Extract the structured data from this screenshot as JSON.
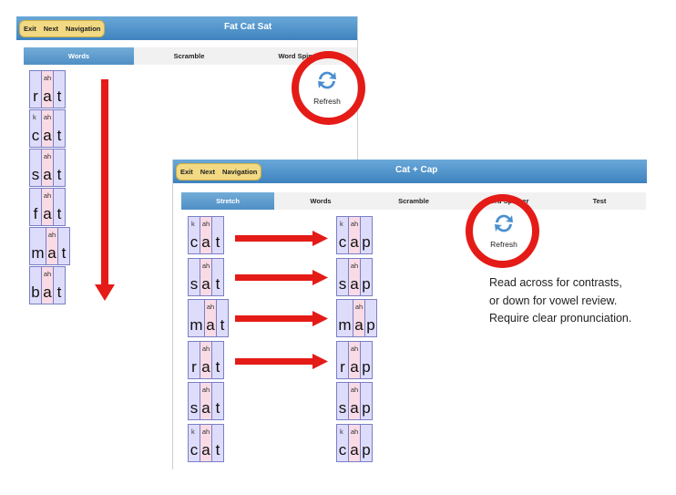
{
  "panel1": {
    "nav": [
      "Exit",
      "Next",
      "Navigation"
    ],
    "title": "Fat Cat Sat",
    "tabs": [
      {
        "label": "Words",
        "active": true
      },
      {
        "label": "Scramble",
        "active": false
      },
      {
        "label": "Word Spinner",
        "active": false
      }
    ],
    "refresh_label": "Refresh",
    "words": [
      [
        {
          "l": "r",
          "h": ""
        },
        {
          "l": "a",
          "h": "ah",
          "v": true
        },
        {
          "l": "t",
          "h": ""
        }
      ],
      [
        {
          "l": "c",
          "h": "k"
        },
        {
          "l": "a",
          "h": "ah",
          "v": true
        },
        {
          "l": "t",
          "h": ""
        }
      ],
      [
        {
          "l": "s",
          "h": ""
        },
        {
          "l": "a",
          "h": "ah",
          "v": true
        },
        {
          "l": "t",
          "h": ""
        }
      ],
      [
        {
          "l": "f",
          "h": ""
        },
        {
          "l": "a",
          "h": "ah",
          "v": true
        },
        {
          "l": "t",
          "h": ""
        }
      ],
      [
        {
          "l": "m",
          "h": ""
        },
        {
          "l": "a",
          "h": "ah",
          "v": true
        },
        {
          "l": "t",
          "h": ""
        }
      ],
      [
        {
          "l": "b",
          "h": ""
        },
        {
          "l": "a",
          "h": "ah",
          "v": true
        },
        {
          "l": "t",
          "h": ""
        }
      ]
    ]
  },
  "panel2": {
    "nav": [
      "Exit",
      "Next",
      "Navigation"
    ],
    "title": "Cat + Cap",
    "tabs": [
      {
        "label": "Stretch",
        "active": true
      },
      {
        "label": "Words",
        "active": false
      },
      {
        "label": "Scramble",
        "active": false
      },
      {
        "label": "Word Spinner",
        "active": false
      },
      {
        "label": "Test",
        "active": false
      }
    ],
    "refresh_label": "Refresh",
    "left_words": [
      [
        {
          "l": "c",
          "h": "k"
        },
        {
          "l": "a",
          "h": "ah",
          "v": true
        },
        {
          "l": "t",
          "h": ""
        }
      ],
      [
        {
          "l": "s",
          "h": ""
        },
        {
          "l": "a",
          "h": "ah",
          "v": true
        },
        {
          "l": "t",
          "h": ""
        }
      ],
      [
        {
          "l": "m",
          "h": ""
        },
        {
          "l": "a",
          "h": "ah",
          "v": true
        },
        {
          "l": "t",
          "h": ""
        }
      ],
      [
        {
          "l": "r",
          "h": ""
        },
        {
          "l": "a",
          "h": "ah",
          "v": true
        },
        {
          "l": "t",
          "h": ""
        }
      ],
      [
        {
          "l": "s",
          "h": ""
        },
        {
          "l": "a",
          "h": "ah",
          "v": true
        },
        {
          "l": "t",
          "h": ""
        }
      ],
      [
        {
          "l": "c",
          "h": "k"
        },
        {
          "l": "a",
          "h": "ah",
          "v": true
        },
        {
          "l": "t",
          "h": ""
        }
      ]
    ],
    "right_words": [
      [
        {
          "l": "c",
          "h": "k"
        },
        {
          "l": "a",
          "h": "ah",
          "v": true
        },
        {
          "l": "p",
          "h": ""
        }
      ],
      [
        {
          "l": "s",
          "h": ""
        },
        {
          "l": "a",
          "h": "ah",
          "v": true
        },
        {
          "l": "p",
          "h": ""
        }
      ],
      [
        {
          "l": "m",
          "h": ""
        },
        {
          "l": "a",
          "h": "ah",
          "v": true
        },
        {
          "l": "p",
          "h": ""
        }
      ],
      [
        {
          "l": "r",
          "h": ""
        },
        {
          "l": "a",
          "h": "ah",
          "v": true
        },
        {
          "l": "p",
          "h": ""
        }
      ],
      [
        {
          "l": "s",
          "h": ""
        },
        {
          "l": "a",
          "h": "ah",
          "v": true
        },
        {
          "l": "p",
          "h": ""
        }
      ],
      [
        {
          "l": "c",
          "h": "k"
        },
        {
          "l": "a",
          "h": "ah",
          "v": true
        },
        {
          "l": "p",
          "h": ""
        }
      ]
    ]
  },
  "instructions": [
    "Read across for contrasts,",
    "or down for vowel review.",
    "Require clear pronunciation."
  ],
  "colors": {
    "annotation_red": "#e41b17",
    "consonant_tile": "#dedcfb",
    "vowel_tile": "#f9dbe6",
    "header_blue": "#4a8cc6",
    "nav_pill": "#f2d983"
  }
}
